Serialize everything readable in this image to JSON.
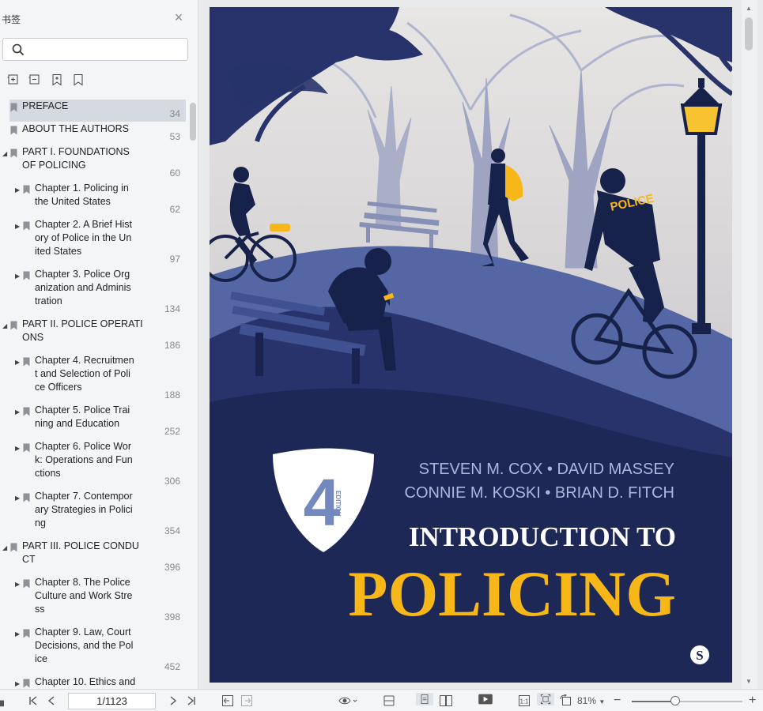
{
  "sidebar": {
    "title": "书签",
    "search_placeholder": "",
    "outline": [
      {
        "label": "PREFACE",
        "page": "34",
        "level": 0,
        "expandable": false,
        "selected": true
      },
      {
        "label": "ABOUT THE AUTHORS",
        "page": "53",
        "level": 0,
        "expandable": false
      },
      {
        "label": "PART I. FOUNDATIONS\nOF POLICING",
        "page": "60",
        "level": 0,
        "expandable": true,
        "expanded": true
      },
      {
        "label": "Chapter 1. Policing in\nthe United States",
        "page": "62",
        "level": 1,
        "expandable": true
      },
      {
        "label": "Chapter 2. A Brief Hist\nory of Police in the Un\nited States",
        "page": "97",
        "level": 1,
        "expandable": true
      },
      {
        "label": "Chapter 3. Police Org\nanization and Adminis\ntration",
        "page": "134",
        "level": 1,
        "expandable": true
      },
      {
        "label": "PART II. POLICE OPERATI\nONS",
        "page": "186",
        "level": 0,
        "expandable": true,
        "expanded": true
      },
      {
        "label": "Chapter 4. Recruitmen\nt and Selection of Poli\nce Officers",
        "page": "188",
        "level": 1,
        "expandable": true
      },
      {
        "label": "Chapter 5. Police Trai\nning and Education",
        "page": "252",
        "level": 1,
        "expandable": true
      },
      {
        "label": "Chapter 6. Police Wor\nk: Operations and Fun\nctions",
        "page": "306",
        "level": 1,
        "expandable": true
      },
      {
        "label": "Chapter 7. Contempor\nary Strategies in Polici\nng",
        "page": "354",
        "level": 1,
        "expandable": true
      },
      {
        "label": "PART III. POLICE CONDU\nCT",
        "page": "396",
        "level": 0,
        "expandable": true,
        "expanded": true
      },
      {
        "label": "Chapter 8. The Police\nCulture and Work Stre\nss",
        "page": "398",
        "level": 1,
        "expandable": true
      },
      {
        "label": "Chapter 9. Law, Court\nDecisions, and the Pol\nice",
        "page": "452",
        "level": 1,
        "expandable": true
      },
      {
        "label": "Chapter 10. Ethics and",
        "page": "",
        "level": 1,
        "expandable": true
      }
    ]
  },
  "cover": {
    "authors_line1": "STEVEN M. COX • DAVID MASSEY",
    "authors_line2": "CONNIE M. KOSKI • BRIAN D. FITCH",
    "edition_number": "4",
    "edition_word": "EDITION",
    "title_line1": "INTRODUCTION TO",
    "title_line2": "POLICING",
    "police_text": "POLICE",
    "publisher_mark": "S"
  },
  "toolbar": {
    "page_indicator": "1/1123",
    "zoom_level": "81%"
  },
  "colors": {
    "cover_navy": "#17224a",
    "cover_yellow": "#f7b718",
    "cover_sky": "#dcdad9"
  }
}
